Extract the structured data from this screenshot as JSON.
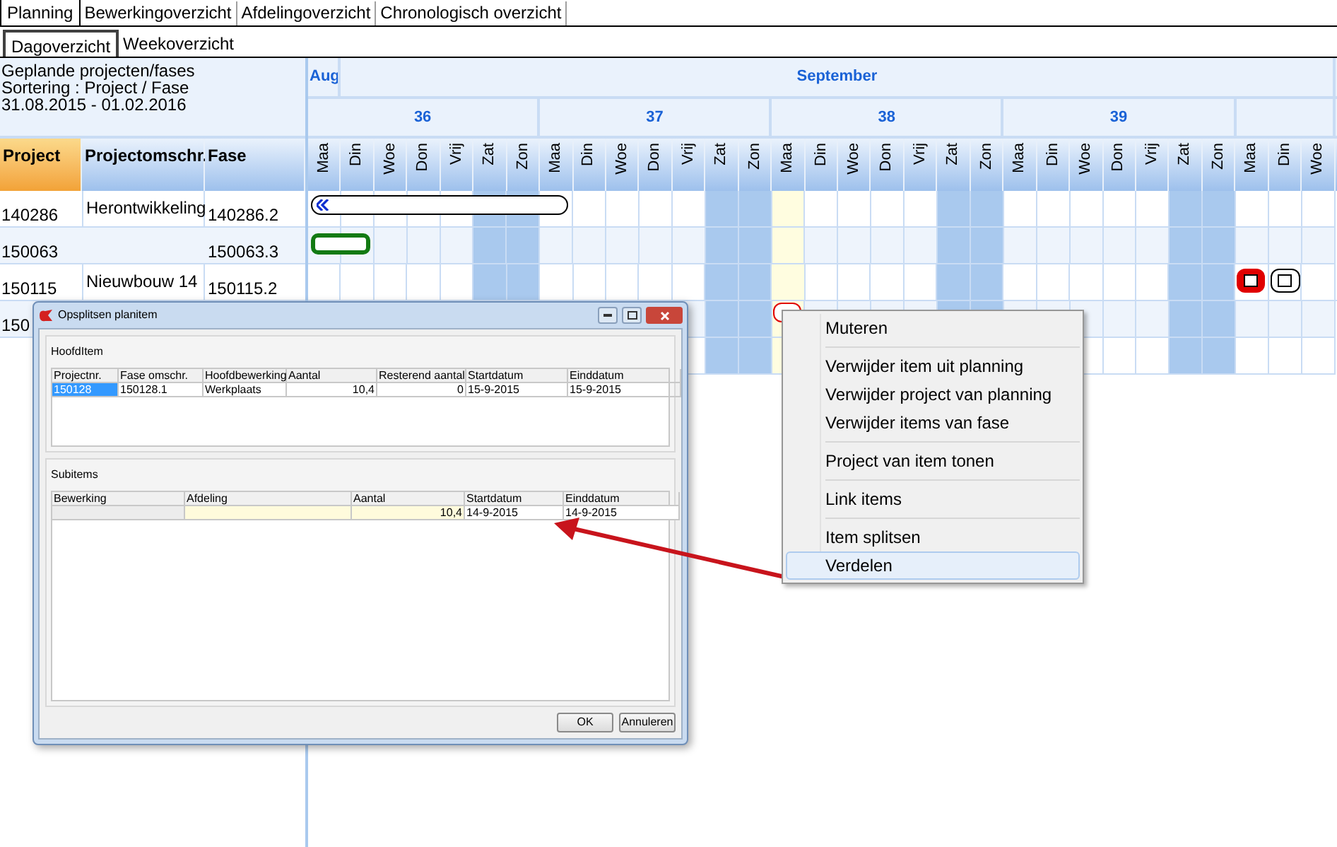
{
  "tabs": [
    {
      "label": "Planning",
      "selected": true
    },
    {
      "label": "Bewerkingoverzicht",
      "selected": false
    },
    {
      "label": "Afdelingoverzicht",
      "selected": false
    },
    {
      "label": "Chronologisch overzicht",
      "selected": false
    }
  ],
  "subtabs": [
    {
      "label": "Dagoverzicht",
      "selected": true
    },
    {
      "label": "Weekoverzicht",
      "selected": false
    }
  ],
  "info": [
    "Geplande projecten/fases",
    "Sortering : Project / Fase",
    "31.08.2015 - 01.02.2016"
  ],
  "columns": [
    {
      "label": "Project",
      "selected": true
    },
    {
      "label": "Projectomschr.",
      "selected": false
    },
    {
      "label": "Fase",
      "selected": false
    }
  ],
  "rows": [
    {
      "project": "140286",
      "description": "Herontwikkeling",
      "phase": "140286.2"
    },
    {
      "project": "150063",
      "phase": "150063.3"
    },
    {
      "project": "150115",
      "description": "Nieuwbouw 14",
      "phase": "150115.2"
    },
    {
      "project": "150"
    }
  ],
  "calendar": {
    "months": [
      "Aug",
      "September"
    ],
    "weeks": [
      "36",
      "37",
      "38",
      "39"
    ],
    "days": [
      {
        "label": "Maa",
        "weekend": false,
        "highlighted": false
      },
      {
        "label": "Din",
        "weekend": false,
        "highlighted": false
      },
      {
        "label": "Woe",
        "weekend": false,
        "highlighted": false
      },
      {
        "label": "Don",
        "weekend": false,
        "highlighted": false
      },
      {
        "label": "Vrij",
        "weekend": false,
        "highlighted": false
      },
      {
        "label": "Zat",
        "weekend": true,
        "highlighted": false
      },
      {
        "label": "Zon",
        "weekend": true,
        "highlighted": false
      },
      {
        "label": "Maa",
        "weekend": false,
        "highlighted": false
      },
      {
        "label": "Din",
        "weekend": false,
        "highlighted": false
      },
      {
        "label": "Woe",
        "weekend": false,
        "highlighted": false
      },
      {
        "label": "Don",
        "weekend": false,
        "highlighted": false
      },
      {
        "label": "Vrij",
        "weekend": false,
        "highlighted": false
      },
      {
        "label": "Zat",
        "weekend": true,
        "highlighted": false
      },
      {
        "label": "Zon",
        "weekend": true,
        "highlighted": false
      },
      {
        "label": "Maa",
        "weekend": false,
        "highlighted": true
      },
      {
        "label": "Din",
        "weekend": false,
        "highlighted": false
      },
      {
        "label": "Woe",
        "weekend": false,
        "highlighted": false
      },
      {
        "label": "Don",
        "weekend": false,
        "highlighted": false
      },
      {
        "label": "Vrij",
        "weekend": false,
        "highlighted": false
      },
      {
        "label": "Zat",
        "weekend": true,
        "highlighted": false
      },
      {
        "label": "Zon",
        "weekend": true,
        "highlighted": false
      },
      {
        "label": "Maa",
        "weekend": false,
        "highlighted": false
      },
      {
        "label": "Din",
        "weekend": false,
        "highlighted": false
      },
      {
        "label": "Woe",
        "weekend": false,
        "highlighted": false
      },
      {
        "label": "Don",
        "weekend": false,
        "highlighted": false
      },
      {
        "label": "Vrij",
        "weekend": false,
        "highlighted": false
      },
      {
        "label": "Zat",
        "weekend": true,
        "highlighted": false
      },
      {
        "label": "Zon",
        "weekend": true,
        "highlighted": false
      },
      {
        "label": "Maa",
        "weekend": false,
        "highlighted": false
      },
      {
        "label": "Din",
        "weekend": false,
        "highlighted": false
      },
      {
        "label": "Woe",
        "weekend": false,
        "highlighted": false
      }
    ],
    "lanes": [
      {
        "items": [
          {
            "kind": "range-bar"
          }
        ]
      },
      {
        "items": [
          {
            "kind": "green-bar"
          }
        ]
      },
      {
        "items": [
          {
            "kind": "red-box"
          },
          {
            "kind": "white-box"
          }
        ]
      },
      {
        "items": [
          {
            "kind": "red-outline"
          }
        ]
      }
    ]
  },
  "dialog": {
    "title": "Opsplitsen planitem",
    "main": {
      "title": "HoofdItem",
      "columns": [
        "Projectnr.",
        "Fase omschr.",
        "Hoofdbewerking",
        "Aantal",
        "Resterend aantal",
        "Startdatum",
        "Einddatum"
      ],
      "rows": [
        [
          {
            "text": "150128",
            "selected": true
          },
          {
            "text": "150128.1",
            "selected": false
          },
          {
            "text": "Werkplaats",
            "selected": false
          },
          {
            "text": "10,4",
            "selected": false
          },
          {
            "text": "0",
            "selected": false
          },
          {
            "text": "15-9-2015",
            "selected": false
          },
          {
            "text": "15-9-2015",
            "selected": false
          }
        ]
      ]
    },
    "sub": {
      "title": "Subitems",
      "columns": [
        "Bewerking",
        "Afdeling",
        "Aantal",
        "Startdatum",
        "Einddatum"
      ],
      "rows": [
        [
          {
            "kind": "readonly"
          },
          {
            "kind": "editable"
          },
          {
            "kind": "editable",
            "text": "10,4"
          },
          {
            "kind": "plain",
            "text": "14-9-2015"
          },
          {
            "kind": "plain",
            "text": "14-9-2015"
          }
        ]
      ]
    },
    "buttons": [
      "OK",
      "Annuleren"
    ]
  },
  "menu": [
    [
      {
        "label": "Muteren",
        "selected": false
      }
    ],
    [
      {
        "label": "Verwijder item uit planning",
        "selected": false
      },
      {
        "label": "Verwijder project van planning",
        "selected": false
      },
      {
        "label": "Verwijder items van fase",
        "selected": false
      }
    ],
    [
      {
        "label": "Project van item tonen",
        "selected": false
      }
    ],
    [
      {
        "label": "Link items",
        "selected": false
      }
    ],
    [
      {
        "label": "Item splitsen",
        "selected": false
      },
      {
        "label": "Verdelen",
        "selected": true
      }
    ]
  ]
}
